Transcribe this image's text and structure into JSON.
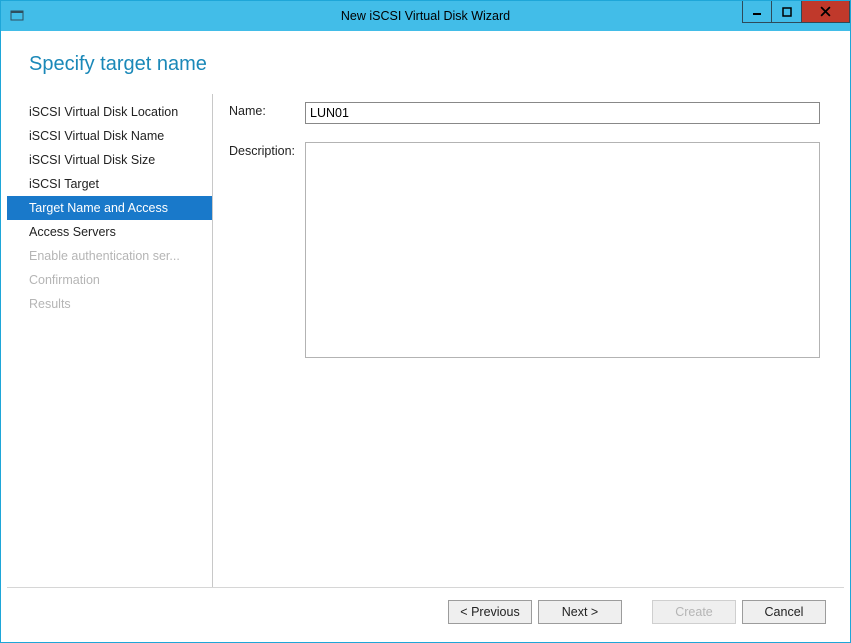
{
  "window": {
    "title": "New iSCSI Virtual Disk Wizard"
  },
  "heading": "Specify target name",
  "sidebar": {
    "items": [
      {
        "label": "iSCSI Virtual Disk Location",
        "state": "normal"
      },
      {
        "label": "iSCSI Virtual Disk Name",
        "state": "normal"
      },
      {
        "label": "iSCSI Virtual Disk Size",
        "state": "normal"
      },
      {
        "label": "iSCSI Target",
        "state": "normal"
      },
      {
        "label": "Target Name and Access",
        "state": "selected"
      },
      {
        "label": "Access Servers",
        "state": "normal"
      },
      {
        "label": "Enable authentication ser...",
        "state": "disabled"
      },
      {
        "label": "Confirmation",
        "state": "disabled"
      },
      {
        "label": "Results",
        "state": "disabled"
      }
    ]
  },
  "form": {
    "name_label": "Name:",
    "name_value": "LUN01",
    "description_label": "Description:",
    "description_value": ""
  },
  "buttons": {
    "previous": "< Previous",
    "next": "Next >",
    "create": "Create",
    "cancel": "Cancel"
  }
}
